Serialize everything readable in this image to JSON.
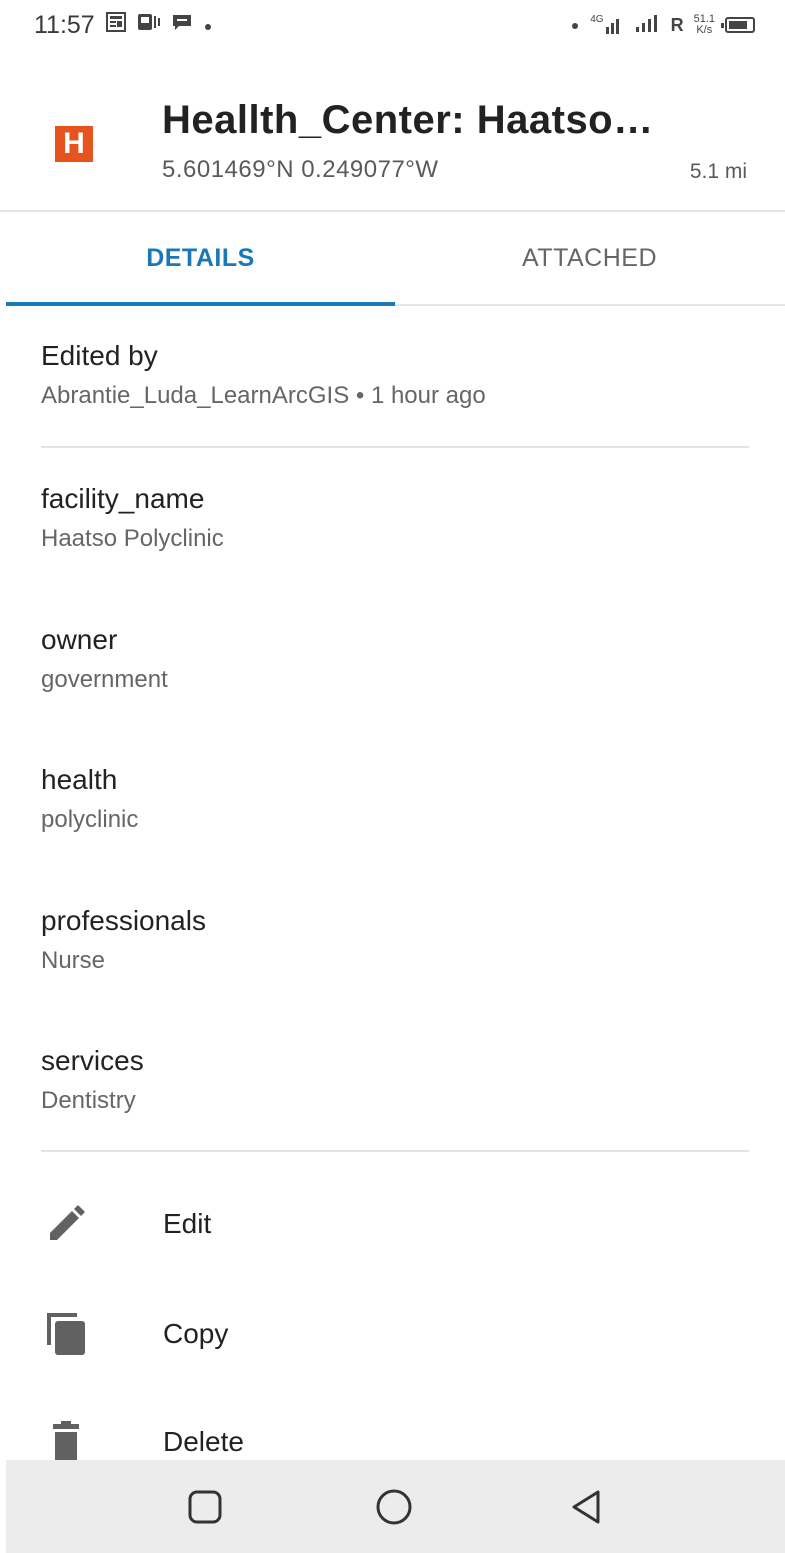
{
  "status_bar": {
    "time": "11:57",
    "network_type": "4G",
    "roaming": "R",
    "speed_value": "51.1",
    "speed_unit": "K/s",
    "battery_level": 0.85
  },
  "header": {
    "logo_letter": "H",
    "logo_color": "#e5541e",
    "title": "Heallth_Center: Haatso…",
    "coordinates": "5.601469°N  0.249077°W",
    "distance": "5.1 mi"
  },
  "tabs": [
    {
      "label": "DETAILS",
      "active": true
    },
    {
      "label": "ATTACHED",
      "active": false
    }
  ],
  "edited": {
    "label": "Edited by",
    "value": "Abrantie_Luda_LearnArcGIS • 1 hour ago"
  },
  "fields": [
    {
      "label": "facility_name",
      "value": "Haatso Polyclinic"
    },
    {
      "label": "owner",
      "value": "government"
    },
    {
      "label": "health",
      "value": "polyclinic"
    },
    {
      "label": "professionals",
      "value": "Nurse"
    },
    {
      "label": "services",
      "value": "Dentistry"
    }
  ],
  "actions": [
    {
      "label": "Edit",
      "icon": "pencil-icon"
    },
    {
      "label": "Copy",
      "icon": "copy-icon"
    },
    {
      "label": "Delete",
      "icon": "trash-icon"
    }
  ],
  "nav": {
    "buttons": [
      "recents-icon",
      "home-icon",
      "back-icon"
    ]
  },
  "colors": {
    "accent": "#1a78b8",
    "navbar": "#ececec"
  }
}
